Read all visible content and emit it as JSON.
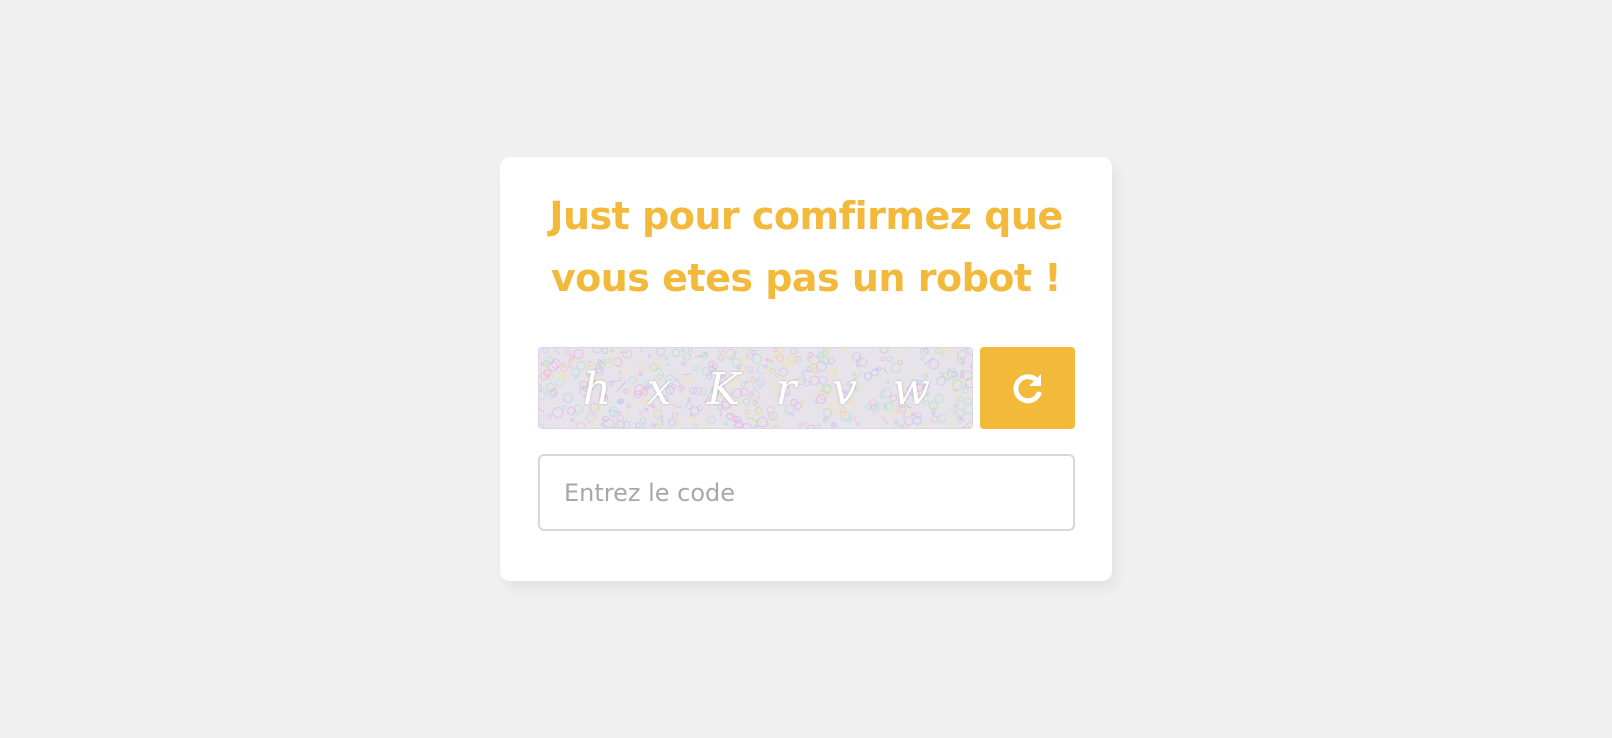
{
  "card": {
    "title": "Just pour comfirmez que vous etes pas un robot !"
  },
  "captcha": {
    "characters": [
      "h",
      "x",
      "K",
      "r",
      "v",
      "w"
    ]
  },
  "refresh_button": {
    "icon": "refresh-icon"
  },
  "code_input": {
    "value": "",
    "placeholder": "Entrez le code"
  },
  "colors": {
    "accent": "#f3b93b",
    "page_background": "#f0f0f0",
    "card_background": "#ffffff",
    "input_border": "#d8d8d8",
    "placeholder": "#a8a8a8"
  }
}
